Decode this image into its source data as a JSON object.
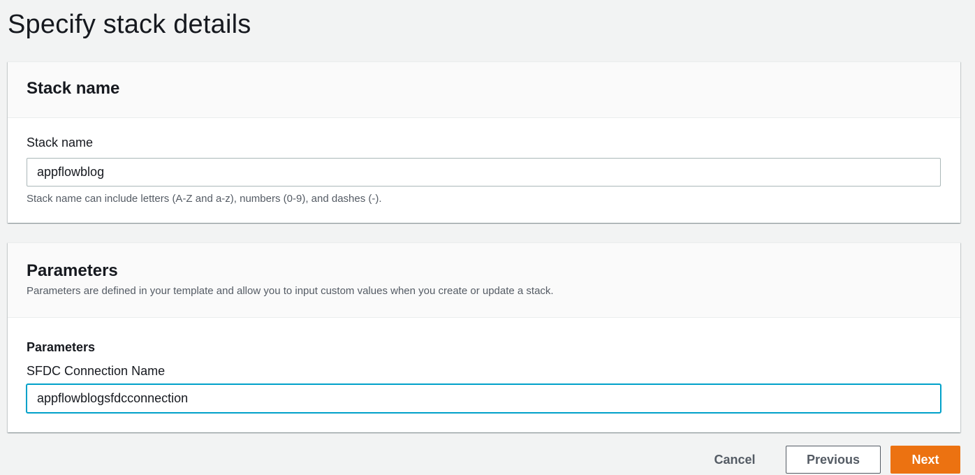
{
  "page": {
    "title": "Specify stack details"
  },
  "stack_name_panel": {
    "header": "Stack name",
    "field_label": "Stack name",
    "field_value": "appflowblog",
    "hint": "Stack name can include letters (A-Z and a-z), numbers (0-9), and dashes (-)."
  },
  "parameters_panel": {
    "header": "Parameters",
    "description": "Parameters are defined in your template and allow you to input custom values when you create or update a stack.",
    "group_label": "Parameters",
    "field_label": "SFDC Connection Name",
    "field_value": "appflowblogsfdcconnection"
  },
  "actions": {
    "cancel": "Cancel",
    "previous": "Previous",
    "next": "Next"
  },
  "colors": {
    "primary": "#ec7211",
    "focus": "#00a1c9",
    "background": "#f2f3f3",
    "text": "#16191f",
    "secondary_text": "#545b64"
  }
}
